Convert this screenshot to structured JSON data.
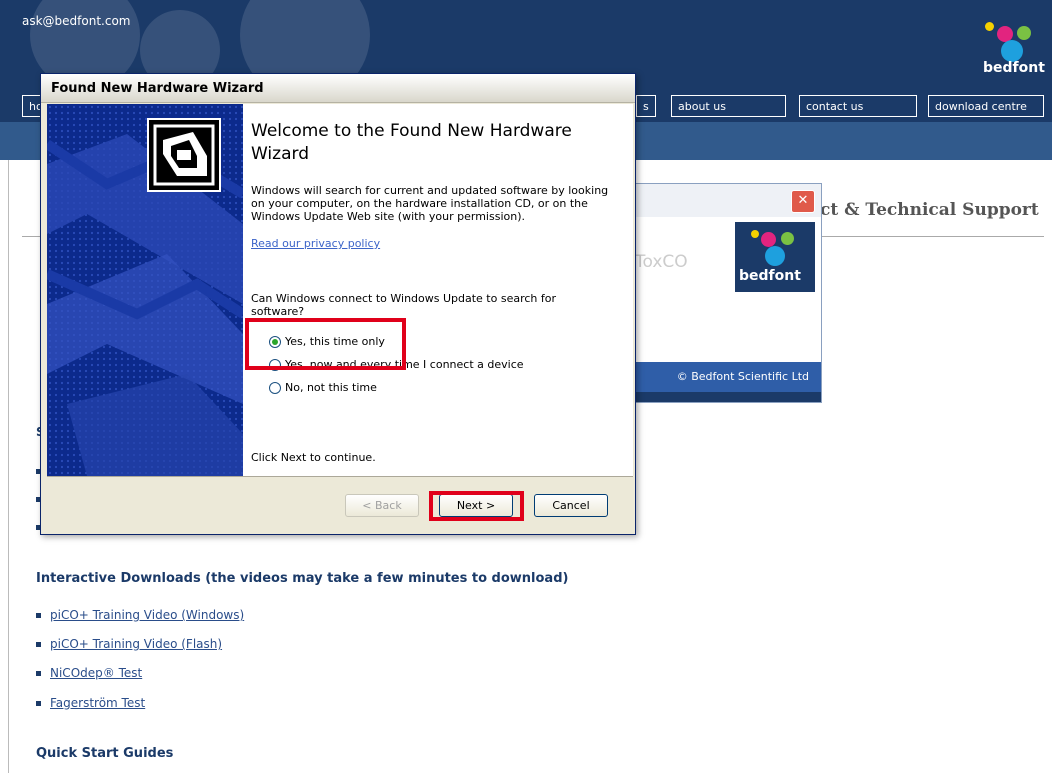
{
  "site": {
    "email": "ask@bedfont.com",
    "logo_text": "bedfont",
    "nav": [
      "ho",
      "s",
      "about us",
      "contact us",
      "download centre"
    ],
    "page_heading": "ct & Technical Support",
    "section_fragment": "S",
    "interactive_title": "Interactive Downloads (the videos may take a few minutes to download)",
    "downloads": [
      "piCO+ Training Video (Windows)",
      "piCO+ Training Video (Flash)",
      "NiCOdep® Test",
      "Fagerström Test"
    ],
    "quick_start_title": "Quick Start Guides"
  },
  "background_dialog": {
    "close_glyph": "✕",
    "product_text": "ToxCO",
    "logo_text": "bedfont",
    "copyright": "© Bedfont Scientific Ltd"
  },
  "wizard": {
    "title": "Found New Hardware Wizard",
    "heading": "Welcome to the Found New Hardware Wizard",
    "body": "Windows will search for current and updated software by looking on your computer, on the hardware installation CD, or on the Windows Update Web site (with your permission).",
    "privacy_link": "Read our privacy policy",
    "question": "Can Windows connect to Windows Update to search for software?",
    "options": [
      {
        "label": "Yes, this time only",
        "selected": true
      },
      {
        "label": "Yes, now and every time I connect a device",
        "selected": false
      },
      {
        "label": "No, not this time",
        "selected": false
      }
    ],
    "continue_text": "Click Next to continue.",
    "back_label": "< Back",
    "next_label": "Next >",
    "cancel_label": "Cancel",
    "hardware_icon": "hardware-chip-icon"
  },
  "colors": {
    "highlight": "#e0001a",
    "site_navy": "#1b3a68",
    "wizard_sidebar": "#0c2a8c"
  }
}
